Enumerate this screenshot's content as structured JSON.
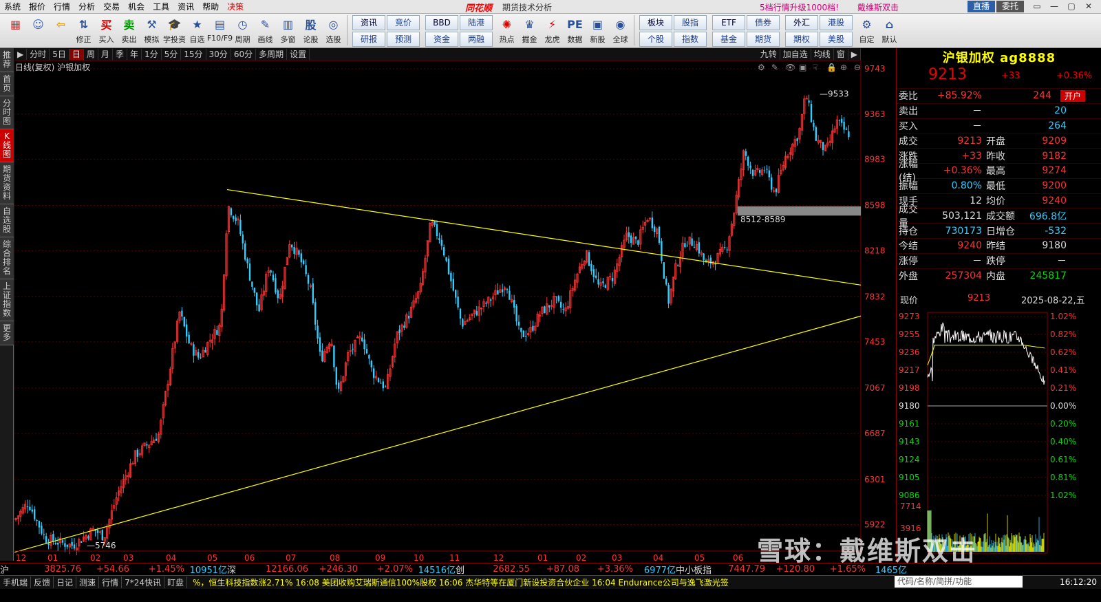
{
  "menubar": {
    "items": [
      "系统",
      "报价",
      "行情",
      "分析",
      "交易",
      "机会",
      "工具",
      "资讯",
      "帮助",
      "决策"
    ],
    "logo": "同花顺",
    "window_title": "期货技术分析",
    "promo": "5档行情升级1000档!",
    "promo2": "戴维斯双击",
    "live": "直播",
    "entrust": "委托"
  },
  "toolbar": {
    "buttons": [
      {
        "icon": "color-grid-icon",
        "label": ""
      },
      {
        "icon": "robot-icon",
        "label": ""
      },
      {
        "icon": "back-arrow-icon",
        "label": ""
      },
      {
        "icon": "modify-icon",
        "label": "修正"
      },
      {
        "icon": "buy-icon",
        "label": "买入"
      },
      {
        "icon": "sell-icon",
        "label": "卖出"
      },
      {
        "icon": "hammer-icon",
        "label": "模拟"
      },
      {
        "icon": "graduation-icon",
        "label": "学投资"
      },
      {
        "icon": "star-icon",
        "label": "自选"
      },
      {
        "icon": "f10-icon",
        "label": "F10/F9"
      },
      {
        "icon": "clock-icon",
        "label": "周期"
      },
      {
        "icon": "pen-icon",
        "label": "画线"
      },
      {
        "icon": "window-icon",
        "label": "多窗"
      },
      {
        "icon": "stock-icon",
        "label": "论股"
      },
      {
        "icon": "filter-icon",
        "label": "选股"
      }
    ],
    "grid1": [
      "资讯",
      "竞价",
      "研报",
      "预测"
    ],
    "grid2": [
      "BBD",
      "陆港",
      "资金",
      "两融"
    ],
    "buttons2": [
      {
        "icon": "hot-icon",
        "label": "热点"
      },
      {
        "icon": "gold-icon",
        "label": "掘金"
      },
      {
        "icon": "dragon-icon",
        "label": "龙虎"
      },
      {
        "icon": "pe-icon",
        "label": "数据"
      },
      {
        "icon": "ipo-icon",
        "label": "新股"
      },
      {
        "icon": "globe-icon",
        "label": "全球"
      }
    ],
    "grid3": [
      "板块",
      "股指",
      "个股",
      "指数"
    ],
    "grid4": [
      "ETF",
      "债券",
      "基金",
      "期货"
    ],
    "grid5": [
      "外汇",
      "港股",
      "期权",
      "美股"
    ],
    "buttons3": [
      {
        "icon": "custom-icon",
        "label": "自定"
      },
      {
        "icon": "home-icon",
        "label": "默认"
      }
    ]
  },
  "leftbar": [
    "推荐",
    "首页",
    "分时图",
    "K线图",
    "期货资料",
    "自选股",
    "综合排名",
    "上证指数",
    "更多"
  ],
  "periods": [
    "分时",
    "5日",
    "日",
    "周",
    "月",
    "季",
    "年",
    "1分",
    "5分",
    "15分",
    "30分",
    "60分",
    "多周期",
    "设置"
  ],
  "right_tools": [
    "九转",
    "加自选",
    "均线",
    "窗"
  ],
  "chart_title": "日线(复权) 沪银加权",
  "chart_data": {
    "type": "candlestick",
    "x_labels": [
      "12",
      "01",
      "02",
      "03",
      "04",
      "05",
      "06",
      "07",
      "08",
      "09",
      "10",
      "11",
      "12",
      "01",
      "02",
      "03",
      "04",
      "05",
      "06"
    ],
    "y_ticks": [
      9743,
      9363,
      8983,
      8598,
      8218,
      7832,
      7453,
      7067,
      6687,
      6301,
      5922
    ],
    "ylim": [
      5700,
      9800
    ],
    "annotations": [
      {
        "text": "9533",
        "price": 9533
      },
      {
        "text": "5746",
        "price": 5746
      },
      {
        "text": "8512-8589",
        "price": 8550
      }
    ],
    "trendlines": [
      {
        "from": {
          "bar": "2024-05",
          "price": 8730
        },
        "to": {
          "bar": "2025-08-22",
          "price": 7930
        }
      },
      {
        "from": {
          "bar": "2023-12",
          "price": 5690
        },
        "to": {
          "bar": "2025-08-22",
          "price": 7670
        }
      }
    ]
  },
  "quote": {
    "name": "沪银加权 ag8888",
    "price": "9213",
    "change": "+33",
    "pct": "+0.36%",
    "rows": [
      {
        "k": "委比",
        "v": "+85.92%",
        "vc": "red",
        "k2": "",
        "v2": "244",
        "v2c": "red",
        "btn": "开户"
      },
      {
        "k": "卖出",
        "v": "－",
        "vc": "wht",
        "k2": "",
        "v2": "20",
        "v2c": "cyan"
      },
      {
        "k": "买入",
        "v": "－",
        "vc": "wht",
        "k2": "",
        "v2": "264",
        "v2c": "cyan"
      },
      {
        "k": "成交",
        "v": "9213",
        "vc": "red",
        "k2": "开盘",
        "v2": "9209",
        "v2c": "red"
      },
      {
        "k": "涨跌",
        "v": "+33",
        "vc": "red",
        "k2": "昨收",
        "v2": "9182",
        "v2c": "red"
      },
      {
        "k": "涨幅(结)",
        "v": "+0.36%",
        "vc": "red",
        "k2": "最高",
        "v2": "9274",
        "v2c": "red"
      },
      {
        "k": "振幅",
        "v": "0.80%",
        "vc": "cyan",
        "k2": "最低",
        "v2": "9200",
        "v2c": "red"
      },
      {
        "k": "现手",
        "v": "12",
        "vc": "wht",
        "k2": "均价",
        "v2": "9240",
        "v2c": "red"
      },
      {
        "k": "成交量",
        "v": "503,121",
        "vc": "wht",
        "k2": "成交额",
        "v2": "696.8亿",
        "v2c": "cyan"
      },
      {
        "k": "持仓",
        "v": "730173",
        "vc": "cyan",
        "k2": "日增仓",
        "v2": "-532",
        "v2c": "cyan"
      },
      {
        "k": "今结",
        "v": "9240",
        "vc": "red",
        "k2": "昨结",
        "v2": "9180",
        "v2c": "wht"
      },
      {
        "k": "涨停",
        "v": "－",
        "vc": "wht",
        "k2": "跌停",
        "v2": "－",
        "v2c": "wht"
      },
      {
        "k": "外盘",
        "v": "257304",
        "vc": "red",
        "k2": "内盘",
        "v2": "245817",
        "v2c": "grn"
      }
    ]
  },
  "mini": {
    "label": "现价",
    "price": "9213",
    "date": "2025-08-22,五",
    "y_left": [
      "9273",
      "9255",
      "9236",
      "9217",
      "9198",
      "9180",
      "9161",
      "9143",
      "9124",
      "9105",
      "9086"
    ],
    "y_right": [
      "1.02%",
      "0.82%",
      "0.62%",
      "0.41%",
      "0.21%",
      "0.00%",
      "0.20%",
      "0.40%",
      "0.61%",
      "0.81%",
      "1.02%"
    ],
    "vol_ticks": [
      "7714",
      "3916"
    ]
  },
  "status": [
    {
      "t": "沪",
      "c": "wht"
    },
    {
      "t": "3825.76",
      "c": "red"
    },
    {
      "t": "+54.66",
      "c": "red"
    },
    {
      "t": "+1.45%",
      "c": "red"
    },
    {
      "t": "10951亿",
      "c": "cyan"
    },
    {
      "t": "深",
      "c": "wht"
    },
    {
      "t": "12166.06",
      "c": "red"
    },
    {
      "t": "+246.30",
      "c": "red"
    },
    {
      "t": "+2.07%",
      "c": "red"
    },
    {
      "t": "14516亿",
      "c": "cyan"
    },
    {
      "t": "创",
      "c": "wht"
    },
    {
      "t": "2682.55",
      "c": "red"
    },
    {
      "t": "+87.08",
      "c": "red"
    },
    {
      "t": "+3.36%",
      "c": "red"
    },
    {
      "t": "6977亿",
      "c": "cyan"
    },
    {
      "t": "中小板指",
      "c": "wht"
    },
    {
      "t": "7447.79",
      "c": "red"
    },
    {
      "t": "+120.80",
      "c": "red"
    },
    {
      "t": "+1.65%",
      "c": "red"
    },
    {
      "t": "1465亿",
      "c": "cyan"
    }
  ],
  "newsbar": {
    "buttons": [
      "手机端",
      "反馈",
      "日记",
      "测速",
      "行情",
      "7*24快讯",
      "盯盘"
    ],
    "news": "%，恒生科技指数涨2.71%        16:08 美团收购艾瑞斯通信100%股权        16:06 杰华特等在厦门新设投资合伙企业        16:04 Endurance公司与逸飞激光签",
    "cmd": "代码/名称/简拼/功能",
    "time": "16:12:20"
  },
  "watermark": "雪球：戴维斯双击"
}
